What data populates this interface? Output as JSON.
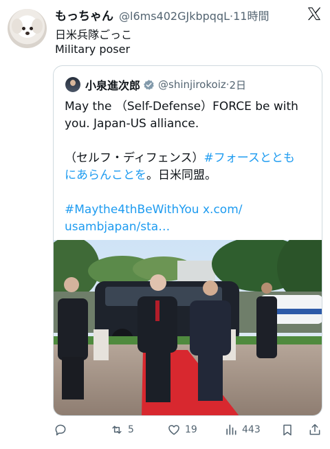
{
  "post": {
    "display_name": "もっちゃん",
    "handle": "@l6ms402GJkbpqqL",
    "time": "11時間",
    "text_line1": "日米兵隊ごっこ",
    "text_line2": "Military poser",
    "avatar_icon": "dog-avatar-icon",
    "platform_icon": "x-logo-icon"
  },
  "quoted": {
    "display_name": "小泉進次郎",
    "handle": "@shinjirokoiz",
    "time": "2日",
    "verified": true,
    "text_en_line1": "May the （Self-Defense）FORCE be with",
    "text_en_line2": "you. Japan-US alliance.",
    "text_jp_line1_plain": "（セルフ・ディフェンス）",
    "text_jp_line1_tag": "#フォースととも",
    "text_jp_line2_tag": "にあらんことを",
    "text_jp_line2_plain": "。日米同盟。",
    "hashtag": "#Maythe4thBeWithYou",
    "link_line1": "x.com/",
    "link_line2": "usambjapan/sta…"
  },
  "actions": {
    "reply_count": "",
    "repost_count": "5",
    "like_count": "19",
    "views_count": "443"
  },
  "colors": {
    "text": "#0f1419",
    "muted": "#536471",
    "link": "#1d9bf0",
    "border": "#cfd9de",
    "verified": "#829aab",
    "carpet": "#d8282f"
  }
}
